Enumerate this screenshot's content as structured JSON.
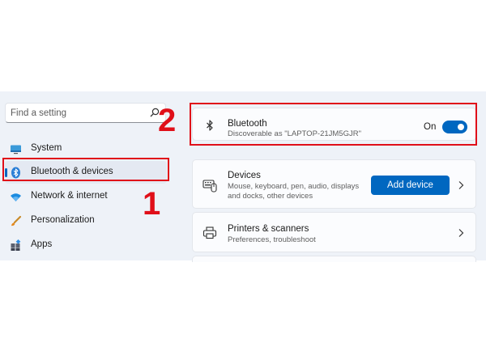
{
  "search": {
    "placeholder": "Find a setting"
  },
  "sidebar": {
    "items": [
      {
        "label": "System",
        "icon": "system-icon"
      },
      {
        "label": "Bluetooth & devices",
        "icon": "bluetooth-icon",
        "selected": true
      },
      {
        "label": "Network & internet",
        "icon": "wifi-icon"
      },
      {
        "label": "Personalization",
        "icon": "brush-icon"
      },
      {
        "label": "Apps",
        "icon": "apps-icon"
      }
    ]
  },
  "bluetooth_card": {
    "title": "Bluetooth",
    "subtitle": "Discoverable as \"LAPTOP-21JM5GJR\"",
    "state_label": "On",
    "toggle_on": true
  },
  "devices_card": {
    "title": "Devices",
    "subtitle_line1": "Mouse, keyboard, pen, audio, displays",
    "subtitle_line2": "and docks, other devices",
    "button_label": "Add device"
  },
  "printers_card": {
    "title": "Printers & scanners",
    "subtitle": "Preferences, troubleshoot"
  },
  "annotations": {
    "step1": "1",
    "step2": "2"
  },
  "colors": {
    "accent": "#0067c0",
    "highlight": "#e00f19",
    "window_bg": "#eef2f8"
  }
}
